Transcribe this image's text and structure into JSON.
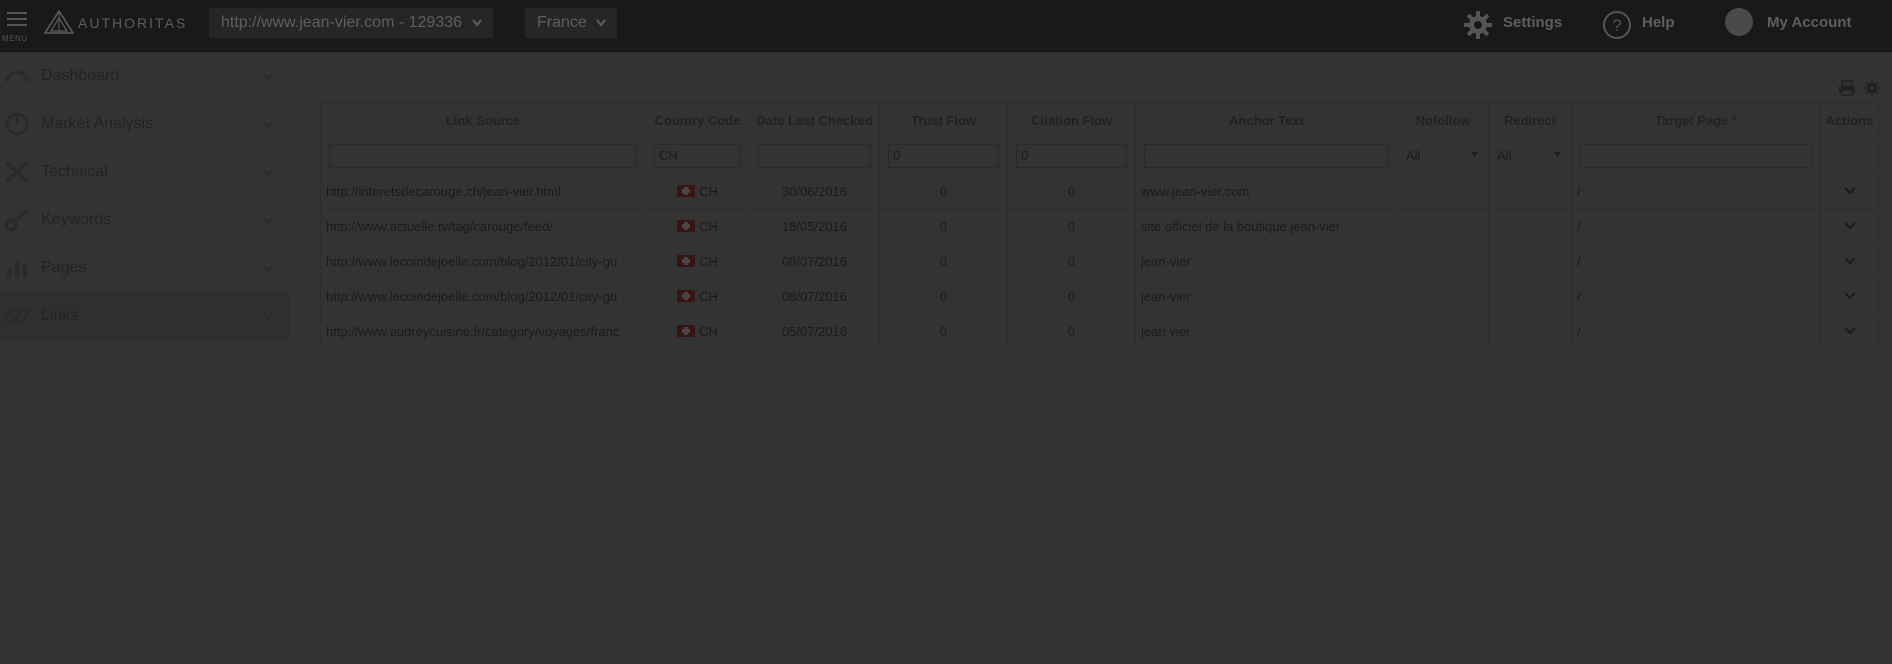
{
  "topbar": {
    "menu_label": "MENU",
    "brand": "AUTHORITAS",
    "site_select": "http://www.jean-vier.com - 129336",
    "country_select": "France",
    "settings_label": "Settings",
    "help_label": "Help",
    "account_label": "My Account"
  },
  "sidebar": {
    "items": [
      {
        "label": "Dashboard",
        "icon": "dashboard-icon"
      },
      {
        "label": "Market Analysis",
        "icon": "market-analysis-icon"
      },
      {
        "label": "Technical",
        "icon": "technical-icon"
      },
      {
        "label": "Keywords",
        "icon": "keywords-icon"
      },
      {
        "label": "Pages",
        "icon": "pages-icon"
      },
      {
        "label": "Links",
        "icon": "links-icon",
        "active": true
      }
    ]
  },
  "table": {
    "headers": [
      "Link Source",
      "Country Code",
      "Date Last Checked",
      "Trust Flow",
      "Citation Flow",
      "Anchor Text",
      "Nofollow",
      "Redirect",
      "Target Page *",
      "Actions"
    ],
    "filters": {
      "link_source": "",
      "country_code": "CH",
      "date_last_checked": "",
      "trust_flow": "0",
      "citation_flow": "0",
      "anchor_text": "",
      "nofollow": "All",
      "redirect": "All",
      "target_page": ""
    },
    "rows": [
      {
        "source": "http://interetsdecarouge.ch/jean-vier.html",
        "country": "CH",
        "date": "30/06/2016",
        "trust": "0",
        "citation": "0",
        "anchor": "www.jean-vier.com",
        "nofollow": "",
        "redirect": "",
        "target": "/"
      },
      {
        "source": "http://www.actuelle.tv/tag/carouge/feed/",
        "country": "CH",
        "date": "18/05/2016",
        "trust": "0",
        "citation": "0",
        "anchor": "site officiel de la boutique jean-vier",
        "nofollow": "",
        "redirect": "",
        "target": "/"
      },
      {
        "source": "http://www.lecoindejoelle.com/blog/2012/01/city-gu",
        "country": "CH",
        "date": "08/07/2016",
        "trust": "0",
        "citation": "0",
        "anchor": "jean-vier",
        "nofollow": "",
        "redirect": "",
        "target": "/"
      },
      {
        "source": "http://www.lecoindejoelle.com/blog/2012/01/city-gu",
        "country": "CH",
        "date": "08/07/2016",
        "trust": "0",
        "citation": "0",
        "anchor": "jean-vier",
        "nofollow": "",
        "redirect": "",
        "target": "/"
      },
      {
        "source": "http://www.audreycuisine.fr/category/voyages/franc",
        "country": "CH",
        "date": "05/07/2016",
        "trust": "0",
        "citation": "0",
        "anchor": "jean vier",
        "nofollow": "",
        "redirect": "",
        "target": "/"
      }
    ]
  }
}
